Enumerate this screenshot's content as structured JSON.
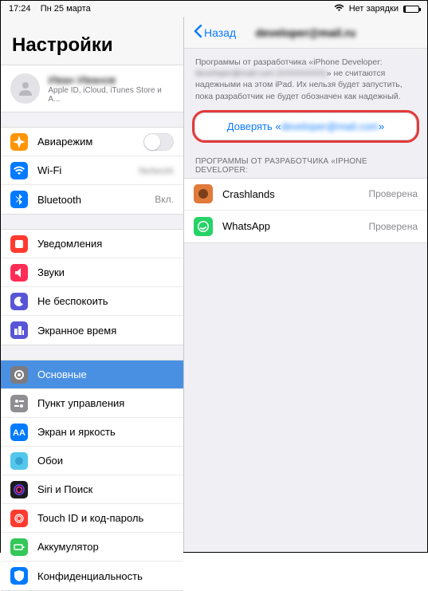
{
  "statusbar": {
    "time": "17:24",
    "date": "Пн 25 марта",
    "charge": "Нет зарядки"
  },
  "left": {
    "title": "Настройки",
    "account": {
      "name": "Иван Иванов",
      "sub": "Apple ID, iCloud, iTunes Store и A..."
    },
    "group1": {
      "airplane": "Авиарежим",
      "wifi": "Wi-Fi",
      "wifi_value": "Network",
      "bluetooth": "Bluetooth",
      "bluetooth_value": "Вкл."
    },
    "group2": {
      "notifications": "Уведомления",
      "sounds": "Звуки",
      "dnd": "Не беспокоить",
      "screentime": "Экранное время"
    },
    "group3": {
      "general": "Основные",
      "control": "Пункт управления",
      "display": "Экран и яркость",
      "wallpaper": "Обои",
      "siri": "Siri и Поиск",
      "touchid": "Touch ID и код-пароль",
      "battery": "Аккумулятор",
      "privacy": "Конфиденциальность"
    }
  },
  "right": {
    "back": "Назад",
    "title": "developer@mail.ru",
    "desc_pre": "Программы от разработчика «iPhone Developer: ",
    "desc_redacted": "developer@mail.com (XXXXXXXX)",
    "desc_post": "» не считаются надежными на этом iPad. Их нельзя будет запустить, пока разработчик не будет обозначен как надежный.",
    "trust_pre": "Доверять «",
    "trust_redacted": "developer@mail.com",
    "trust_post": "»",
    "section_header": "ПРОГРАММЫ ОТ РАЗРАБОТЧИКА «IPHONE DEVELOPER:",
    "apps": {
      "crashlands": {
        "name": "Crashlands",
        "status": "Проверена"
      },
      "whatsapp": {
        "name": "WhatsApp",
        "status": "Проверена"
      }
    }
  }
}
